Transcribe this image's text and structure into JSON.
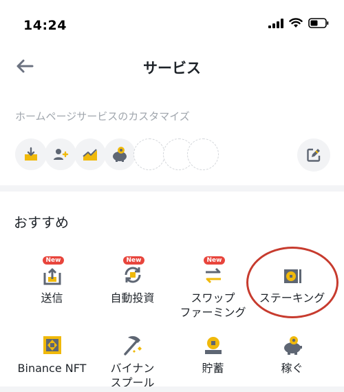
{
  "status_bar": {
    "time": "14:24",
    "icons": [
      "signal-icon",
      "wifi-icon",
      "battery-icon"
    ]
  },
  "header": {
    "back_icon": "back-arrow-icon",
    "title": "サービス"
  },
  "customize": {
    "label": "ホームページサービスのカスタマイズ",
    "shortcuts": [
      "deposit-icon",
      "add-user-icon",
      "trend-chart-icon",
      "piggy-bank-icon"
    ],
    "empty_slots": 3,
    "edit_icon": "edit-icon"
  },
  "recommended": {
    "title": "おすすめ",
    "badge_text": "New",
    "items": [
      {
        "label": "送信",
        "icon": "send-icon",
        "is_new": true
      },
      {
        "label": "自動投資",
        "icon": "auto-invest-icon",
        "is_new": true
      },
      {
        "label": "スワップ\nファーミング",
        "icon": "swap-farming-icon",
        "is_new": true
      },
      {
        "label": "ステーキング",
        "icon": "staking-icon",
        "is_new": false,
        "highlighted": true
      },
      {
        "label": "Binance NFT",
        "icon": "nft-icon",
        "is_new": false
      },
      {
        "label": "バイナン\nスプール",
        "icon": "pickaxe-icon",
        "is_new": false
      },
      {
        "label": "貯蓄",
        "icon": "savings-icon",
        "is_new": false
      },
      {
        "label": "稼ぐ",
        "icon": "earn-icon",
        "is_new": false
      }
    ]
  },
  "colors": {
    "accent": "#f0b90b",
    "icon_dark": "#5e6673",
    "badge": "#e8453c",
    "highlight_ring": "#c73b2e"
  }
}
